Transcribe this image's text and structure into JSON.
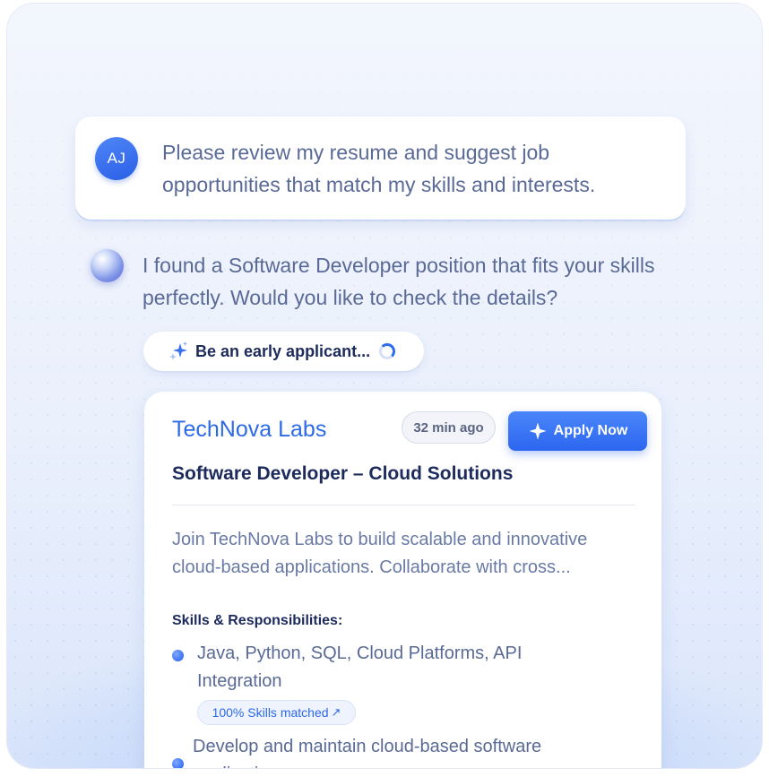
{
  "user_message": {
    "avatar_initials": "AJ",
    "text": "Please review my resume and suggest job opportunities that match my skills and interests."
  },
  "ai_message": {
    "text": "I found a Software Developer position that fits your skills perfectly. Would you like to check the details?",
    "early_pill": {
      "label": "Be an early applicant...",
      "icon": "sparkle-icon",
      "status_icon": "spinner-icon"
    }
  },
  "job_card": {
    "company": "TechNova Labs",
    "posted": "32 min ago",
    "apply_label": "Apply Now",
    "title": "Software Developer – Cloud Solutions",
    "description": "Join TechNova Labs to build scalable and innovative cloud-based applications. Collaborate with cross...",
    "skills_heading": "Skills & Responsibilities:",
    "skills": [
      {
        "text": "Java, Python, SQL, Cloud Platforms, API Integration",
        "match": "100% Skills matched"
      },
      {
        "text": "Develop and maintain cloud-based software applications"
      }
    ]
  },
  "colors": {
    "accent": "#2d6ae6",
    "heading": "#1c2a5c",
    "body_text": "#5a6a96"
  }
}
